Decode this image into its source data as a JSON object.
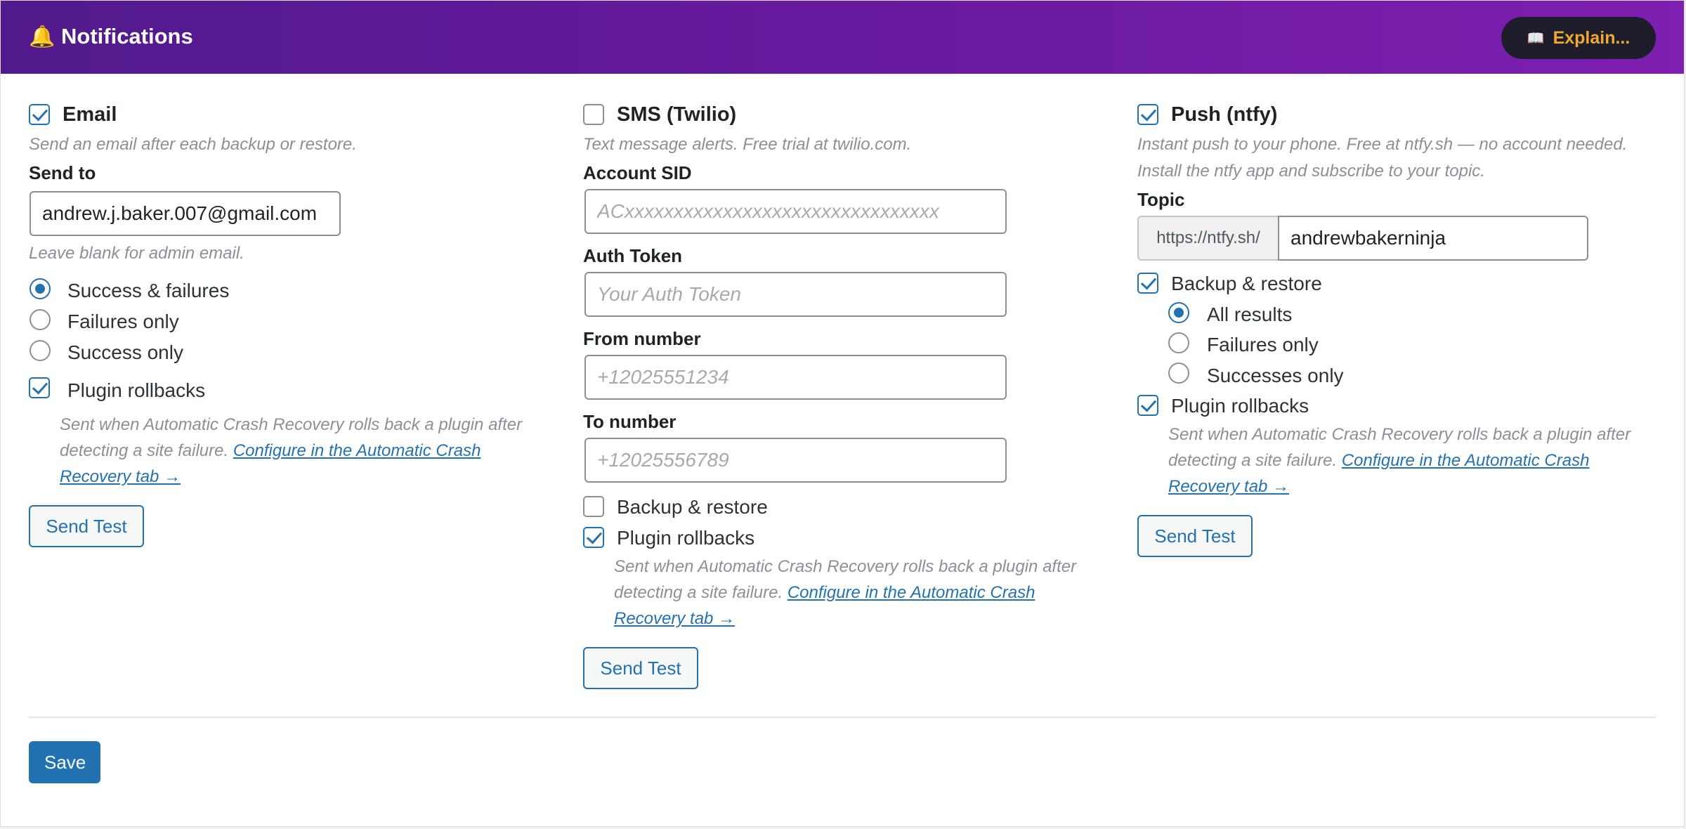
{
  "header": {
    "icon": "bell-icon",
    "icon_glyph": "🔔",
    "title": "Notifications",
    "explain_icon": "book-icon",
    "explain_glyph": "📖",
    "explain_label": "Explain..."
  },
  "email": {
    "enabled": true,
    "title": "Email",
    "description": "Send an email after each backup or restore.",
    "send_to_label": "Send to",
    "send_to_value": "andrew.j.baker.007@gmail.com",
    "send_to_hint": "Leave blank for admin email.",
    "options": [
      {
        "label": "Success & failures",
        "selected": true
      },
      {
        "label": "Failures only",
        "selected": false
      },
      {
        "label": "Success only",
        "selected": false
      }
    ],
    "rollbacks_label": "Plugin rollbacks",
    "rollbacks_enabled": true,
    "rollbacks_note": "Sent when Automatic Crash Recovery rolls back a plugin after detecting a site failure.",
    "rollbacks_link": "Configure in the Automatic Crash Recovery tab →",
    "send_test_label": "Send Test"
  },
  "sms": {
    "enabled": false,
    "title": "SMS (Twilio)",
    "description": "Text message alerts. Free trial at twilio.com.",
    "account_sid_label": "Account SID",
    "account_sid_placeholder": "ACxxxxxxxxxxxxxxxxxxxxxxxxxxxxxxxx",
    "auth_token_label": "Auth Token",
    "auth_token_placeholder": "Your Auth Token",
    "from_label": "From number",
    "from_placeholder": "+12025551234",
    "to_label": "To number",
    "to_placeholder": "+12025556789",
    "backup_restore_label": "Backup & restore",
    "backup_restore_enabled": false,
    "rollbacks_label": "Plugin rollbacks",
    "rollbacks_enabled": true,
    "rollbacks_note": "Sent when Automatic Crash Recovery rolls back a plugin after detecting a site failure.",
    "rollbacks_link": "Configure in the Automatic Crash Recovery tab →",
    "send_test_label": "Send Test"
  },
  "push": {
    "enabled": true,
    "title": "Push (ntfy)",
    "description": "Instant push to your phone. Free at ntfy.sh — no account needed. Install the ntfy app and subscribe to your topic.",
    "topic_label": "Topic",
    "topic_prefix": "https://ntfy.sh/",
    "topic_value": "andrewbakerninja",
    "backup_restore_label": "Backup & restore",
    "backup_restore_enabled": true,
    "options": [
      {
        "label": "All results",
        "selected": true
      },
      {
        "label": "Failures only",
        "selected": false
      },
      {
        "label": "Successes only",
        "selected": false
      }
    ],
    "rollbacks_label": "Plugin rollbacks",
    "rollbacks_enabled": true,
    "rollbacks_note": "Sent when Automatic Crash Recovery rolls back a plugin after detecting a site failure.",
    "rollbacks_link": "Configure in the Automatic Crash Recovery tab →",
    "send_test_label": "Send Test"
  },
  "footer": {
    "save_label": "Save"
  }
}
